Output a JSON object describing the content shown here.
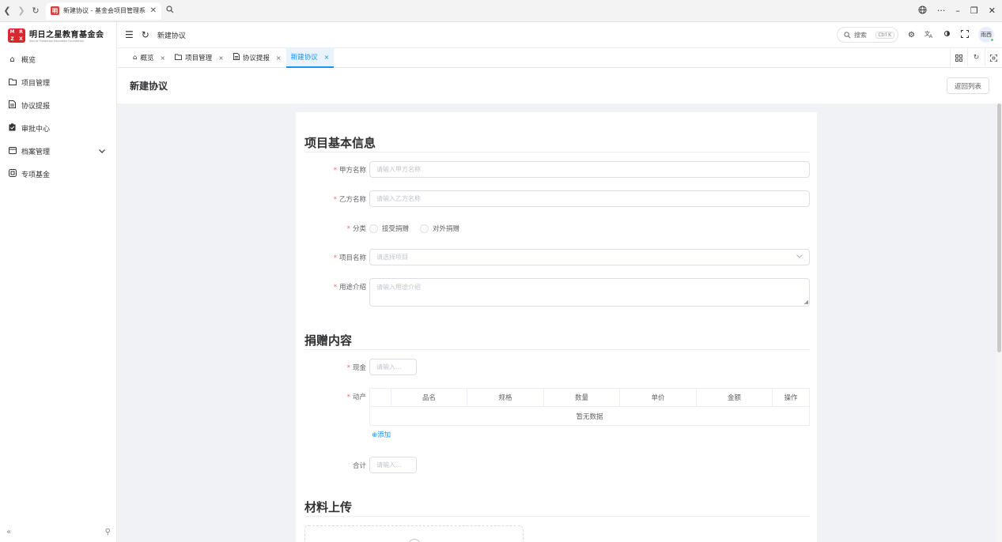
{
  "browser": {
    "tab_title": "新建协议 - 基金会项目管理系",
    "favicon": "明",
    "tab_close": "✕",
    "menu_dots": "···",
    "minimize": "–",
    "restore": "❐",
    "close": "✕"
  },
  "sidebar": {
    "logo_mark": [
      "M",
      "R",
      "Z",
      "X"
    ],
    "logo_cn": "明日之星教育基金会",
    "logo_en": "Star of Tomorrow Education Foundation",
    "items": [
      {
        "label": "概览",
        "icon": "home-icon"
      },
      {
        "label": "项目管理",
        "icon": "folder-icon"
      },
      {
        "label": "协议提报",
        "icon": "document-icon"
      },
      {
        "label": "审批中心",
        "icon": "clipboard-icon"
      },
      {
        "label": "档案管理",
        "icon": "archive-icon",
        "has_submenu": true
      },
      {
        "label": "专项基金",
        "icon": "fund-icon"
      }
    ],
    "collapse_icon": "«",
    "pin_icon": "⚲"
  },
  "header": {
    "breadcrumb": "新建协议",
    "search_label": "搜索",
    "search_shortcut": "Ctrl K",
    "avatar_text": "雨西"
  },
  "tags": [
    {
      "label": "概览",
      "icon": "home-icon",
      "active": false
    },
    {
      "label": "项目管理",
      "icon": "folder-icon",
      "active": false
    },
    {
      "label": "协议提报",
      "icon": "document-icon",
      "active": false
    },
    {
      "label": "新建协议",
      "icon": "",
      "active": true
    }
  ],
  "page": {
    "title": "新建协议",
    "back_button": "返回列表"
  },
  "form": {
    "section_basic": "项目基本信息",
    "party_a_label": "甲方名称",
    "party_a_placeholder": "请输入甲方名称",
    "party_b_label": "乙方名称",
    "party_b_placeholder": "请输入乙方名称",
    "category_label": "分类",
    "category_options": [
      "接受捐赠",
      "对外捐赠"
    ],
    "project_label": "项目名称",
    "project_placeholder": "请选择项目",
    "purpose_label": "用途介绍",
    "purpose_placeholder": "请输入用途介绍",
    "section_donation": "捐赠内容",
    "cash_label": "现金",
    "cash_placeholder": "请输入...",
    "movable_label": "动产",
    "table_headers": [
      "",
      "品名",
      "规格",
      "数量",
      "单价",
      "金额",
      "操作"
    ],
    "table_empty": "暂无数据",
    "add_link": "⊕添加",
    "total_label": "合计",
    "total_placeholder": "请输入...",
    "section_upload": "材料上传"
  },
  "colors": {
    "primary": "#1890ff",
    "required": "#f56c6c",
    "brand_red": "#d8282e"
  }
}
